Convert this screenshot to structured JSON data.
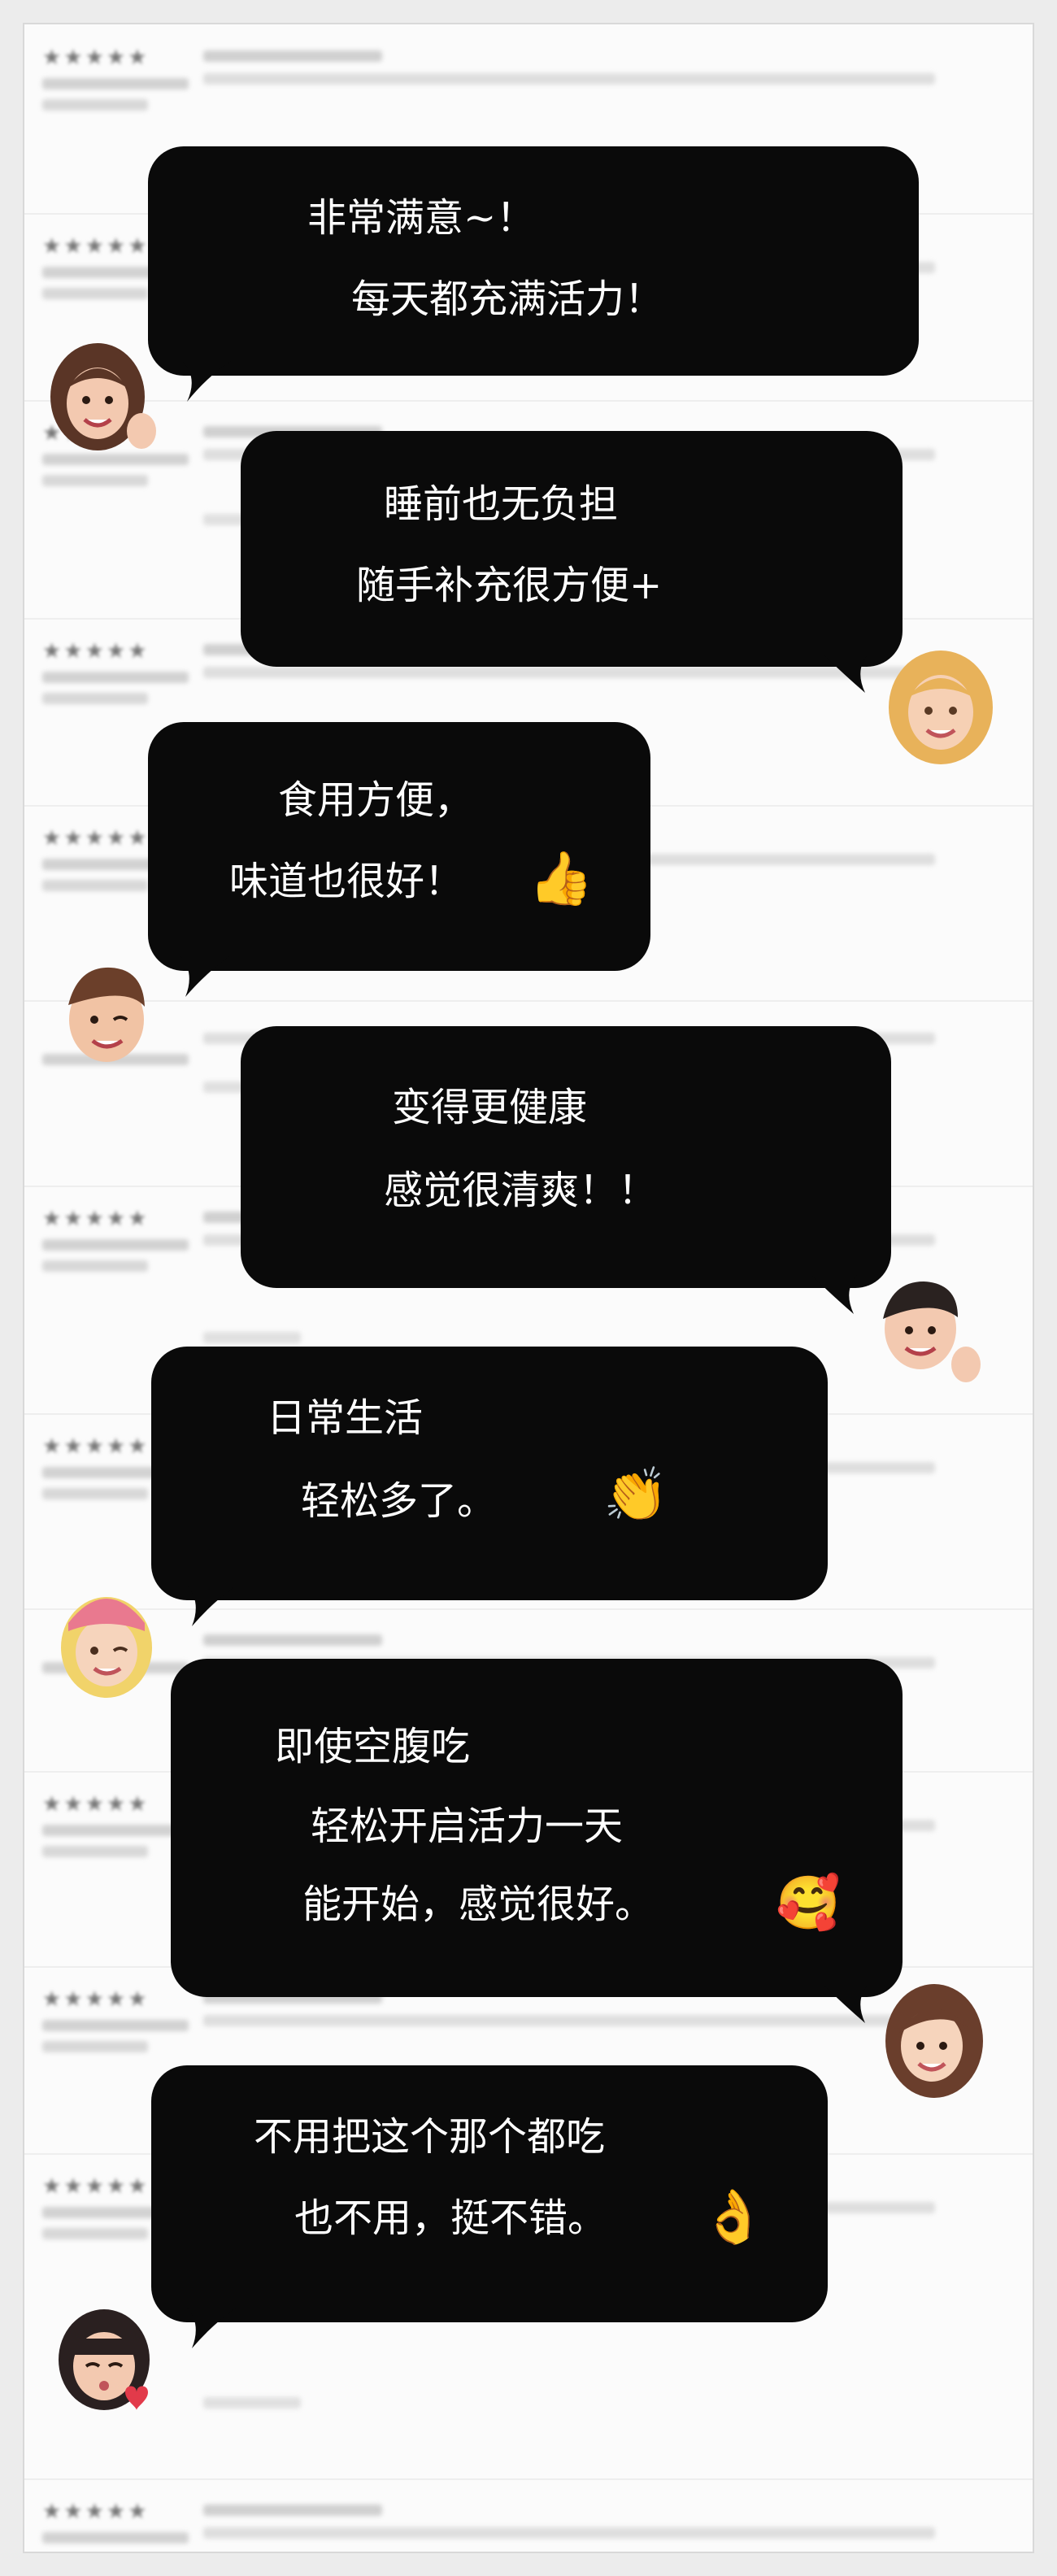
{
  "reviews_background_count": 13,
  "bubbles": [
    {
      "lines": [
        "非常满意~！",
        "每天都充满活力！"
      ],
      "emoji": ""
    },
    {
      "lines": [
        "睡前也无负担",
        "随手补充很方便+"
      ],
      "emoji": ""
    },
    {
      "lines": [
        "食用方便，",
        "味道也很好！"
      ],
      "emoji": "👍"
    },
    {
      "lines": [
        "变得更健康",
        "感觉很清爽！！"
      ],
      "emoji": ""
    },
    {
      "lines": [
        "日常生活",
        "轻松多了。"
      ],
      "emoji": "👏"
    },
    {
      "lines": [
        "即使空腹吃",
        "轻松开启活力一天",
        "能开始，感觉很好。"
      ],
      "emoji": "🥰"
    },
    {
      "lines": [
        "不用把这个那个都吃",
        "也不用，挺不错。"
      ],
      "emoji": "👌"
    }
  ],
  "avatars": [
    "memoji-woman-brown-hair-thumbs-up-icon",
    "memoji-woman-blonde-curly-icon",
    "memoji-man-winking-icon",
    "memoji-boy-thumbs-up-icon",
    "memoji-girl-pink-beanie-winking-icon",
    "memoji-woman-long-hair-icon",
    "memoji-girl-blowing-kiss-icon"
  ]
}
